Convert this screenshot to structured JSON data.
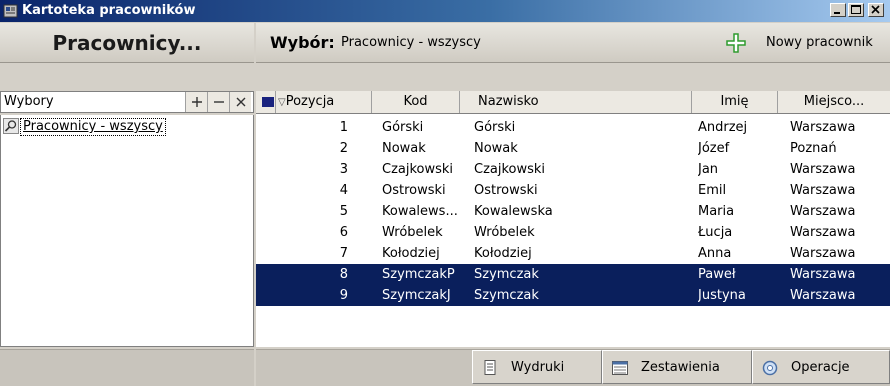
{
  "window": {
    "title": "Kartoteka pracowników"
  },
  "left": {
    "header": "Pracownicy...",
    "choices_label": "Wybory",
    "tree": [
      {
        "label": "Pracownicy - wszyscy"
      }
    ]
  },
  "right": {
    "selection_label": "Wybór:",
    "selection_value": "Pracownicy - wszyscy",
    "new_employee_label": "Nowy pracownik",
    "columns": [
      "Pozycja",
      "Kod",
      "Nazwisko",
      "Imię",
      "Miejsco..."
    ],
    "rows": [
      {
        "pozycja": "1",
        "kod": "Górski",
        "nazwisko": "Górski",
        "imie": "Andrzej",
        "miejsce": "Warszawa",
        "selected": false
      },
      {
        "pozycja": "2",
        "kod": "Nowak",
        "nazwisko": "Nowak",
        "imie": "Józef",
        "miejsce": "Poznań",
        "selected": false
      },
      {
        "pozycja": "3",
        "kod": "Czajkowski",
        "nazwisko": "Czajkowski",
        "imie": "Jan",
        "miejsce": "Warszawa",
        "selected": false
      },
      {
        "pozycja": "4",
        "kod": "Ostrowski",
        "nazwisko": "Ostrowski",
        "imie": "Emil",
        "miejsce": "Warszawa",
        "selected": false
      },
      {
        "pozycja": "5",
        "kod": "Kowalews...",
        "nazwisko": "Kowalewska",
        "imie": "Maria",
        "miejsce": "Warszawa",
        "selected": false
      },
      {
        "pozycja": "6",
        "kod": "Wróbelek",
        "nazwisko": "Wróbelek",
        "imie": "Łucja",
        "miejsce": "Warszawa",
        "selected": false
      },
      {
        "pozycja": "7",
        "kod": "Kołodziej",
        "nazwisko": "Kołodziej",
        "imie": "Anna",
        "miejsce": "Warszawa",
        "selected": false
      },
      {
        "pozycja": "8",
        "kod": "SzymczakP",
        "nazwisko": "Szymczak",
        "imie": "Paweł",
        "miejsce": "Warszawa",
        "selected": true
      },
      {
        "pozycja": "9",
        "kod": "SzymczakJ",
        "nazwisko": "Szymczak",
        "imie": "Justyna",
        "miejsce": "Warszawa",
        "selected": true
      }
    ]
  },
  "toolbar": {
    "reports": "Wydruki",
    "summaries": "Zestawienia",
    "operations": "Operacje"
  },
  "colors": {
    "selected_row": "#0a1f5c",
    "title_bar": "#0a246a",
    "plus_icon": "#2e9b2e"
  }
}
